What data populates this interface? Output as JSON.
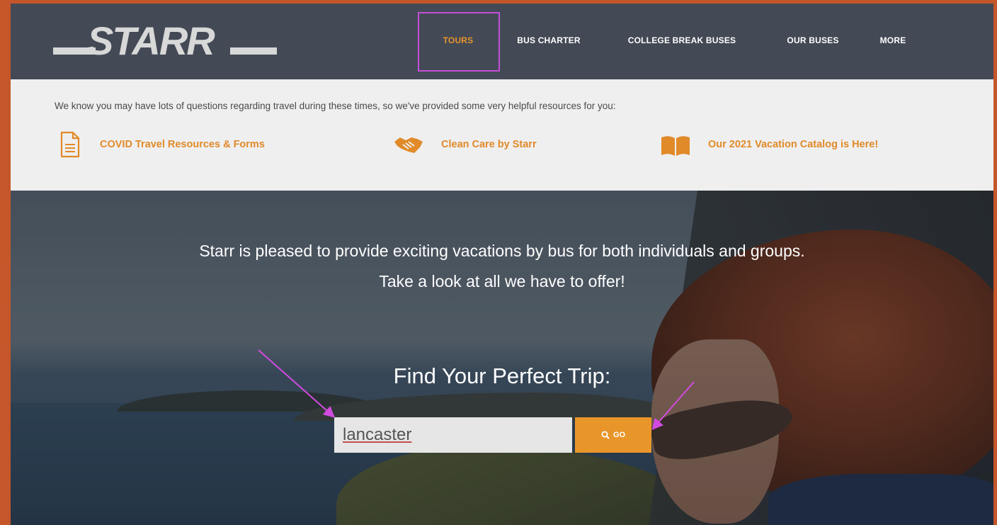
{
  "header": {
    "logo_text": "STARR",
    "nav": [
      {
        "label": "TOURS"
      },
      {
        "label": "BUS CHARTER"
      },
      {
        "label": "COLLEGE BREAK BUSES"
      },
      {
        "label": "OUR BUSES"
      },
      {
        "label": "MORE"
      }
    ],
    "active_nav": "TOURS"
  },
  "infobar": {
    "message": "We know you may have lots of questions regarding travel during these times, so we've provided some very helpful resources for you:",
    "resources": [
      {
        "icon": "document-icon",
        "label": "COVID Travel Resources & Forms"
      },
      {
        "icon": "handshake-icon",
        "label": "Clean Care by Starr"
      },
      {
        "icon": "book-icon",
        "label": "Our 2021 Vacation Catalog is Here!"
      }
    ]
  },
  "hero": {
    "line1": "Starr is pleased to provide exciting vacations by bus for both individuals and groups.",
    "line2": "Take a look at all we have to offer!",
    "find_title": "Find Your Perfect Trip:",
    "search_value": "lancaster",
    "go_label": "GO"
  },
  "colors": {
    "frame": "#c4562a",
    "header_bg": "#434a55",
    "accent": "#e8962a",
    "highlight": "#c54ed8",
    "infobar_bg": "#efefef"
  }
}
